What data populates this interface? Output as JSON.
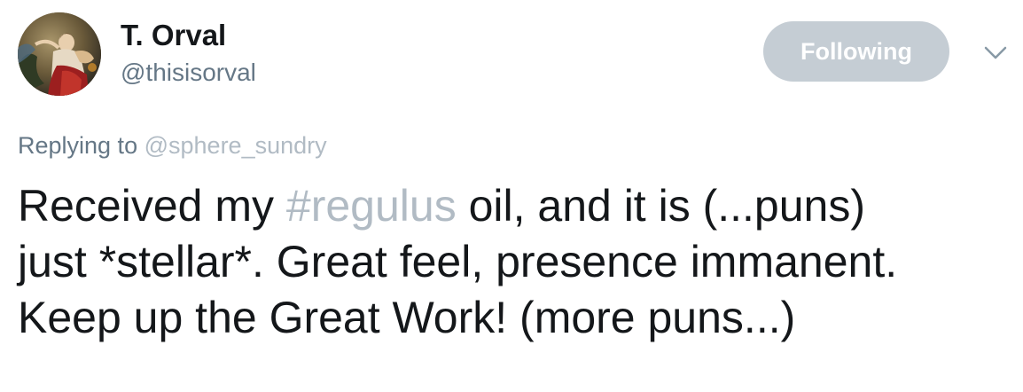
{
  "author": {
    "name": "T. Orval",
    "handle": "@thisisorval"
  },
  "actions": {
    "follow_label": "Following",
    "menu_icon": "chevron-down-icon"
  },
  "reply": {
    "prefix": "Replying to",
    "mention": "@sphere_sundry"
  },
  "tweet": {
    "line1_before": "Received my ",
    "hashtag": "#regulus",
    "line1_after": " oil, and it is (...puns)",
    "line2": "just *stellar*. Great feel, presence immanent.",
    "line3": "Keep up the Great Work! (more puns...)"
  },
  "colors": {
    "text": "#14171a",
    "secondary": "#657786",
    "link_muted": "#b1bbc4",
    "following_button": "#c5cdd4"
  }
}
